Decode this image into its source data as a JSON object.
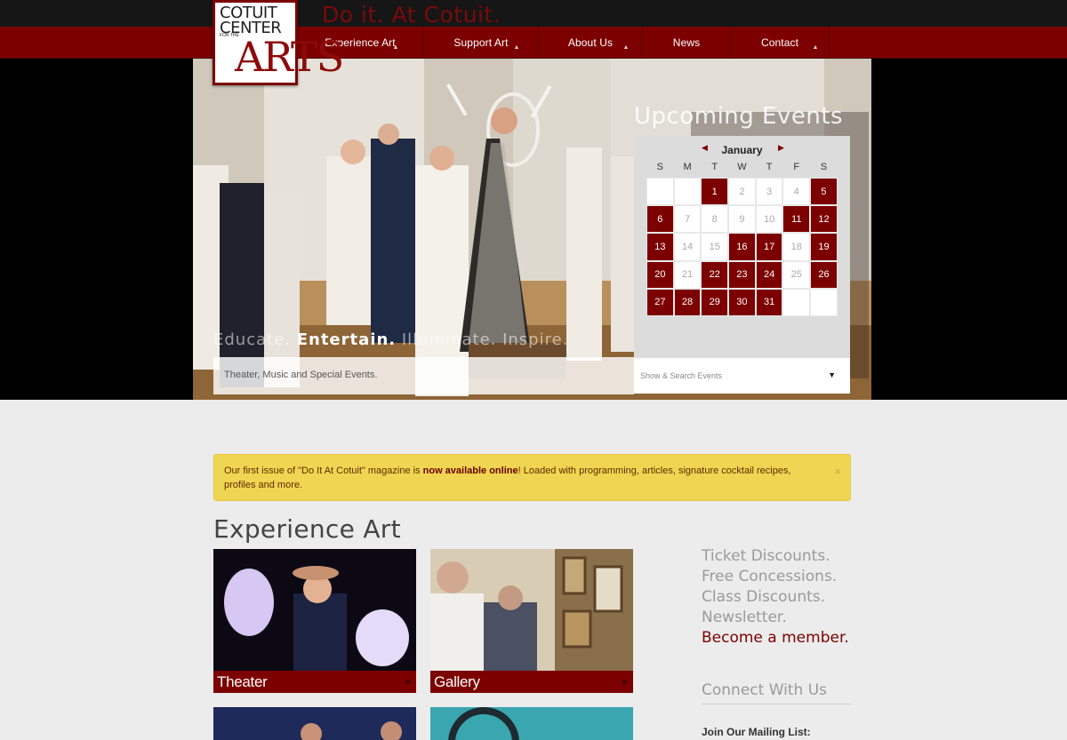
{
  "header": {
    "tagline": "Do it. At Cotuit.",
    "logo": {
      "line1": "COTUIT",
      "line2": "CENTER",
      "small": "FOR THE",
      "line3": "ARTS"
    },
    "nav": [
      {
        "label": "Experience Art",
        "has_dropdown": true
      },
      {
        "label": "Support Art",
        "has_dropdown": true
      },
      {
        "label": "About Us",
        "has_dropdown": true
      },
      {
        "label": "News",
        "has_dropdown": false
      },
      {
        "label": "Contact",
        "has_dropdown": true
      }
    ]
  },
  "hero": {
    "motto_1": "Educate. ",
    "motto_2": "Entertain.",
    "motto_3": " Illuminate. Inspire.",
    "subtitle": "Theater, Music and Special Events."
  },
  "events": {
    "title": "Upcoming Events",
    "month": "January",
    "weekdays": [
      "S",
      "M",
      "T",
      "W",
      "T",
      "F",
      "S"
    ],
    "cells": [
      {
        "d": ""
      },
      {
        "d": ""
      },
      {
        "d": "1",
        "ev": true
      },
      {
        "d": "2"
      },
      {
        "d": "3"
      },
      {
        "d": "4"
      },
      {
        "d": "5",
        "ev": true
      },
      {
        "d": "6",
        "ev": true
      },
      {
        "d": "7"
      },
      {
        "d": "8"
      },
      {
        "d": "9"
      },
      {
        "d": "10"
      },
      {
        "d": "11",
        "ev": true
      },
      {
        "d": "12",
        "ev": true
      },
      {
        "d": "13",
        "ev": true
      },
      {
        "d": "14"
      },
      {
        "d": "15"
      },
      {
        "d": "16",
        "ev": true
      },
      {
        "d": "17",
        "ev": true
      },
      {
        "d": "18"
      },
      {
        "d": "19",
        "ev": true
      },
      {
        "d": "20",
        "ev": true
      },
      {
        "d": "21"
      },
      {
        "d": "22",
        "ev": true
      },
      {
        "d": "23",
        "ev": true
      },
      {
        "d": "24",
        "ev": true
      },
      {
        "d": "25"
      },
      {
        "d": "26",
        "ev": true
      },
      {
        "d": "27",
        "ev": true
      },
      {
        "d": "28",
        "ev": true
      },
      {
        "d": "29",
        "ev": true
      },
      {
        "d": "30",
        "ev": true
      },
      {
        "d": "31",
        "ev": true
      },
      {
        "d": ""
      },
      {
        "d": ""
      }
    ],
    "show_search": "Show & Search Events"
  },
  "alert": {
    "pre": "Our first issue of \"Do It At Cotuit\" magazine is ",
    "bold": "now available online",
    "post": "!  Loaded with programming, articles, signature cocktail recipes, profiles and more.",
    "close": "×"
  },
  "experience": {
    "title": "Experience Art",
    "tiles": [
      {
        "label": "Theater"
      },
      {
        "label": "Gallery"
      }
    ]
  },
  "sidebar": {
    "perks": [
      "Ticket Discounts.",
      "Free Concessions.",
      "Class Discounts.",
      "Newsletter."
    ],
    "member_link": "Become a member.",
    "connect": "Connect With Us",
    "mailing": "Join Our Mailing List:"
  },
  "colors": {
    "brand": "#7c0000",
    "alert": "#f0d552",
    "background": "#ececec"
  }
}
